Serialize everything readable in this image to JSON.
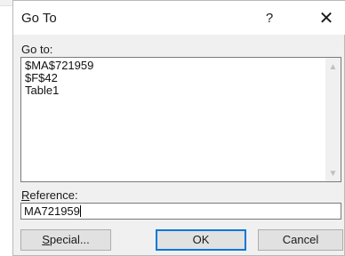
{
  "dialog": {
    "title": "Go To",
    "help_label": "?",
    "close_label": "✕"
  },
  "goto": {
    "label": "Go to:",
    "items": [
      "$MA$721959",
      "$F$42",
      "Table1"
    ]
  },
  "reference": {
    "label_underlined": "R",
    "label_rest": "eference:",
    "value": "MA721959"
  },
  "buttons": {
    "special_underlined": "S",
    "special_rest": "pecial...",
    "ok_label": "OK",
    "cancel_label": "Cancel"
  },
  "scroll": {
    "up_icon": "▲",
    "down_icon": "▼"
  }
}
